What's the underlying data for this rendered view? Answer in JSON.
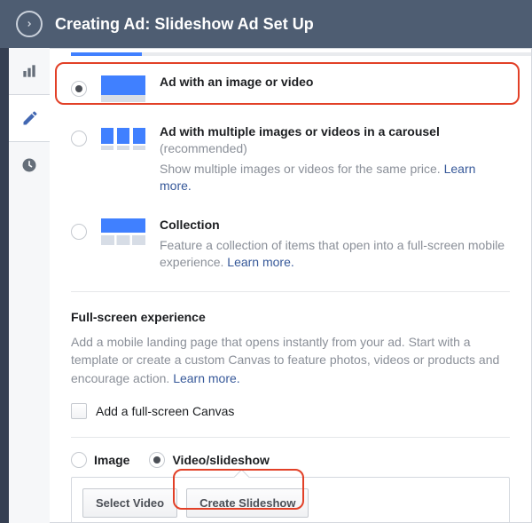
{
  "header": {
    "title": "Creating Ad: Slideshow Ad Set Up"
  },
  "format_options": [
    {
      "key": "single",
      "title": "Ad with an image or video",
      "subtitle": "",
      "desc": "",
      "learn_more": "",
      "selected": true
    },
    {
      "key": "carousel",
      "title": "Ad with multiple images or videos in a carousel",
      "subtitle": "(recommended)",
      "desc": "Show multiple images or videos for the same price. ",
      "learn_more": "Learn more.",
      "selected": false
    },
    {
      "key": "collection",
      "title": "Collection",
      "subtitle": "",
      "desc": "Feature a collection of items that open into a full-screen mobile experience. ",
      "learn_more": "Learn more.",
      "selected": false
    }
  ],
  "fullscreen": {
    "title": "Full-screen experience",
    "desc": "Add a mobile landing page that opens instantly from your ad. Start with a template or create a custom Canvas to feature photos, videos or products and encourage action. ",
    "learn_more": "Learn more.",
    "canvas_checkbox_label": "Add a full-screen Canvas"
  },
  "media": {
    "image_label": "Image",
    "video_label": "Video/slideshow",
    "selected": "video",
    "select_video_btn": "Select Video",
    "create_slideshow_btn": "Create Slideshow"
  }
}
